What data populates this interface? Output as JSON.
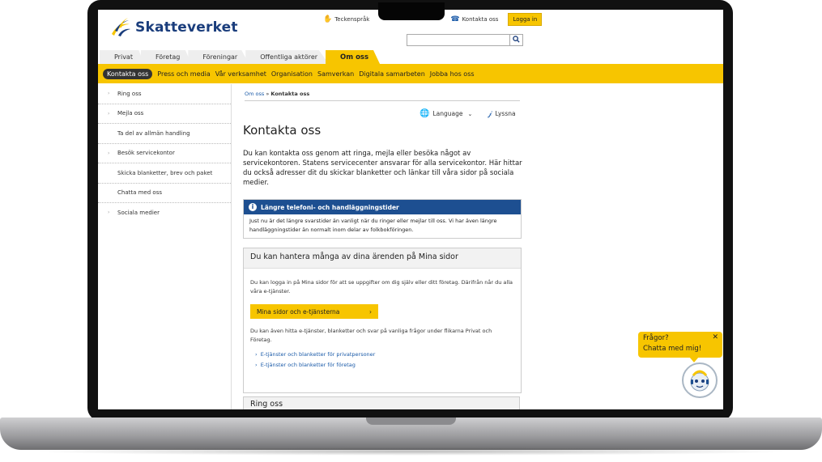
{
  "brand": {
    "name": "Skatteverket",
    "colors": {
      "accent": "#f7c500",
      "primary": "#1a3d7c",
      "info": "#1d4f91",
      "link": "#1a5aa8"
    }
  },
  "header": {
    "top_links": [
      {
        "label": "Teckenspråk",
        "icon": "sign-language-icon"
      },
      {
        "label": "Kontakta oss",
        "icon": "phone-icon"
      }
    ],
    "login_label": "Logga in",
    "search": {
      "placeholder": "",
      "icon": "search-icon"
    }
  },
  "tabs": [
    {
      "label": "Privat"
    },
    {
      "label": "Företag"
    },
    {
      "label": "Föreningar"
    },
    {
      "label": "Offentliga aktörer"
    },
    {
      "label": "Om oss",
      "active": true
    }
  ],
  "subnav": [
    {
      "label": "Kontakta oss",
      "active": true
    },
    {
      "label": "Press och media"
    },
    {
      "label": "Vår verksamhet"
    },
    {
      "label": "Organisation"
    },
    {
      "label": "Samverkan"
    },
    {
      "label": "Digitala samarbeten"
    },
    {
      "label": "Jobba hos oss"
    }
  ],
  "sidebar": {
    "items": [
      {
        "label": "Ring oss",
        "arrow": true
      },
      {
        "label": "Mejla oss",
        "arrow": true
      },
      {
        "label": "Ta del av allmän handling",
        "arrow": false
      },
      {
        "label": "Besök servicekontor",
        "arrow": true
      },
      {
        "label": "Skicka blanketter, brev och paket",
        "arrow": false
      },
      {
        "label": "Chatta med oss",
        "arrow": false
      },
      {
        "label": "Sociala medier",
        "arrow": true
      }
    ]
  },
  "breadcrumb": {
    "parent": "Om oss",
    "separator": "»",
    "current": "Kontakta oss"
  },
  "tools": {
    "language_label": "Language",
    "listen_label": "Lyssna"
  },
  "main": {
    "title": "Kontakta oss",
    "intro": "Du kan kontakta oss genom att ringa, mejla eller besöka något av servicekontoren. Statens servicecenter ansvarar för alla servicekontor. Här hittar du också adresser dit du skickar blanketter och länkar till våra sidor på sociala medier.",
    "info": {
      "title": "Längre telefoni- och handläggningstider",
      "body": "Just nu är det längre svarstider än vanligt när du ringer eller mejlar till oss. Vi har även längre handläggningstider än normalt inom delar av folkbokföringen."
    },
    "card": {
      "title": "Du kan hantera många av dina ärenden på Mina sidor",
      "text1": "Du kan logga in på Mina sidor för att se uppgifter om dig själv eller ditt företag. Därifrån når du alla våra e-tjänster.",
      "button_label": "Mina sidor och e-tjänsterna",
      "text2": "Du kan även hitta e-tjänster, blanketter och svar på vanliga frågor under flikarna Privat och Företag.",
      "links": [
        {
          "label": "E-tjänster och blanketter för privatpersoner"
        },
        {
          "label": "E-tjänster och blanketter för företag"
        }
      ]
    },
    "next_card_title": "Ring oss"
  },
  "chat": {
    "line1": "Frågor?",
    "line2": "Chatta med mig!"
  }
}
